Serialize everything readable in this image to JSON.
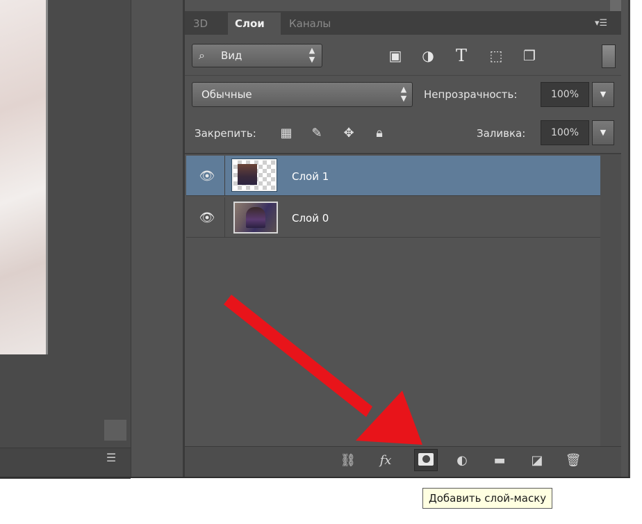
{
  "tabs": [
    {
      "label": "3D"
    },
    {
      "label": "Слои"
    },
    {
      "label": "Каналы"
    }
  ],
  "filter": {
    "kind_label": "Вид",
    "icons": [
      "pixel-layer-filter-icon",
      "adjustment-layer-filter-icon",
      "type-layer-filter-icon",
      "shape-layer-filter-icon",
      "smart-object-filter-icon"
    ]
  },
  "blend": {
    "mode": "Обычные",
    "opacity_label": "Непрозрачность:",
    "opacity_value": "100%"
  },
  "lock": {
    "label": "Закрепить:",
    "fill_label": "Заливка:",
    "fill_value": "100%"
  },
  "layers": [
    {
      "name": "Слой 1",
      "selected": true,
      "visible": true
    },
    {
      "name": "Слой 0",
      "selected": false,
      "visible": true
    }
  ],
  "bottom_toolbar": {
    "fx_label": "fx",
    "icons": [
      "link-layers-icon",
      "fx-icon",
      "add-layer-mask-icon",
      "adjustment-layer-icon",
      "group-folder-icon",
      "new-layer-icon",
      "trash-icon"
    ]
  },
  "tooltip": {
    "text": "Добавить слой-маску"
  },
  "colors": {
    "panel_bg": "#535353",
    "selected_layer": "#5f7c99",
    "arrow": "#e8141a",
    "tooltip_bg": "#ffffe1"
  }
}
